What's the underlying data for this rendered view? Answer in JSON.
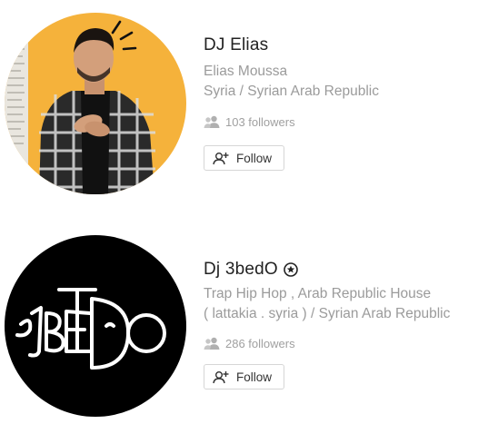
{
  "results": [
    {
      "display_name": "DJ Elias",
      "full_name": "Elias Moussa",
      "location": "Syria / Syrian Arab Republic",
      "followers": "103 followers",
      "follow_label": "Follow",
      "pro_badge": false,
      "avatar_bg": "#f5b23b"
    },
    {
      "display_name": "Dj 3bedO",
      "genres": "Trap Hip Hop , Arab Republic House",
      "location": "( lattakia . syria ) / Syrian Arab Republic",
      "followers": "286 followers",
      "follow_label": "Follow",
      "pro_badge": true,
      "avatar_bg": "#000000",
      "avatar_logo_text": "3BeDO"
    }
  ]
}
